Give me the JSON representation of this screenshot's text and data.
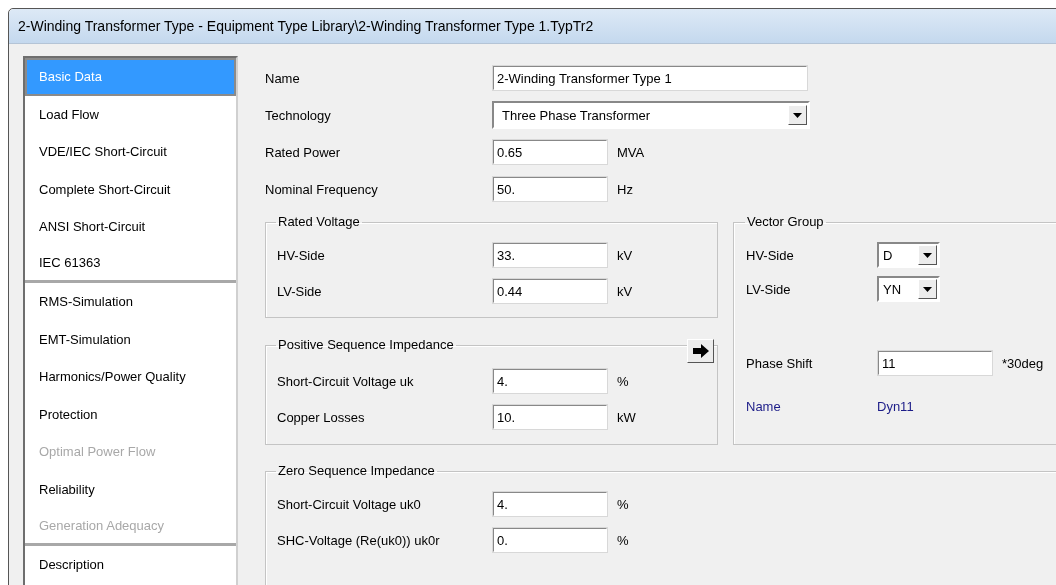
{
  "window": {
    "title": "2-Winding Transformer Type - Equipment Type Library\\2-Winding Transformer Type 1.TypTr2"
  },
  "sidebar": {
    "items": [
      {
        "label": "Basic Data",
        "selected": true,
        "disabled": false,
        "separator_after": false
      },
      {
        "label": "Load Flow",
        "selected": false,
        "disabled": false,
        "separator_after": false
      },
      {
        "label": "VDE/IEC Short-Circuit",
        "selected": false,
        "disabled": false,
        "separator_after": false
      },
      {
        "label": "Complete Short-Circuit",
        "selected": false,
        "disabled": false,
        "separator_after": false
      },
      {
        "label": "ANSI Short-Circuit",
        "selected": false,
        "disabled": false,
        "separator_after": false
      },
      {
        "label": "IEC 61363",
        "selected": false,
        "disabled": false,
        "separator_after": true
      },
      {
        "label": "RMS-Simulation",
        "selected": false,
        "disabled": false,
        "separator_after": false
      },
      {
        "label": "EMT-Simulation",
        "selected": false,
        "disabled": false,
        "separator_after": false
      },
      {
        "label": "Harmonics/Power Quality",
        "selected": false,
        "disabled": false,
        "separator_after": false
      },
      {
        "label": "Protection",
        "selected": false,
        "disabled": false,
        "separator_after": false
      },
      {
        "label": "Optimal Power Flow",
        "selected": false,
        "disabled": true,
        "separator_after": false
      },
      {
        "label": "Reliability",
        "selected": false,
        "disabled": false,
        "separator_after": false
      },
      {
        "label": "Generation Adequacy",
        "selected": false,
        "disabled": true,
        "separator_after": true
      },
      {
        "label": "Description",
        "selected": false,
        "disabled": false,
        "separator_after": false
      }
    ]
  },
  "general": [
    {
      "kind": "text",
      "label": "Name",
      "value": "2-Winding Transformer Type 1"
    },
    {
      "kind": "dropdown",
      "label": "Technology",
      "value": "Three Phase Transformer"
    },
    {
      "kind": "number",
      "label": "Rated Power",
      "value": "0.65",
      "unit": "MVA"
    },
    {
      "kind": "number",
      "label": "Nominal Frequency",
      "value": "50.",
      "unit": "Hz"
    }
  ],
  "rated_voltage": {
    "title": "Rated Voltage",
    "rows": [
      {
        "kind": "number",
        "label": "HV-Side",
        "value": "33.",
        "unit": "kV"
      },
      {
        "kind": "number",
        "label": "LV-Side",
        "value": "0.44",
        "unit": "kV"
      }
    ]
  },
  "positive_sequence": {
    "title": "Positive Sequence Impedance",
    "rows": [
      {
        "kind": "number",
        "label": "Short-Circuit Voltage uk",
        "value": "4.",
        "unit": "%"
      },
      {
        "kind": "number",
        "label": "Copper Losses",
        "value": "10.",
        "unit": "kW"
      }
    ]
  },
  "vector_group": {
    "title": "Vector Group",
    "rows": [
      {
        "kind": "combo",
        "label": "HV-Side",
        "value": "D"
      },
      {
        "kind": "combo",
        "label": "LV-Side",
        "value": "YN"
      },
      {
        "kind": "number",
        "label": "Phase Shift",
        "value": "11",
        "unit": "*30deg"
      },
      {
        "kind": "readout",
        "label": "Name",
        "value": "Dyn11"
      }
    ]
  },
  "zero_sequence": {
    "title": "Zero Sequence Impedance",
    "rows": [
      {
        "kind": "number",
        "label": "Short-Circuit Voltage uk0",
        "value": "4.",
        "unit": "%"
      },
      {
        "kind": "number",
        "label": "SHC-Voltage (Re(uk0)) uk0r",
        "value": "0.",
        "unit": "%"
      }
    ]
  }
}
